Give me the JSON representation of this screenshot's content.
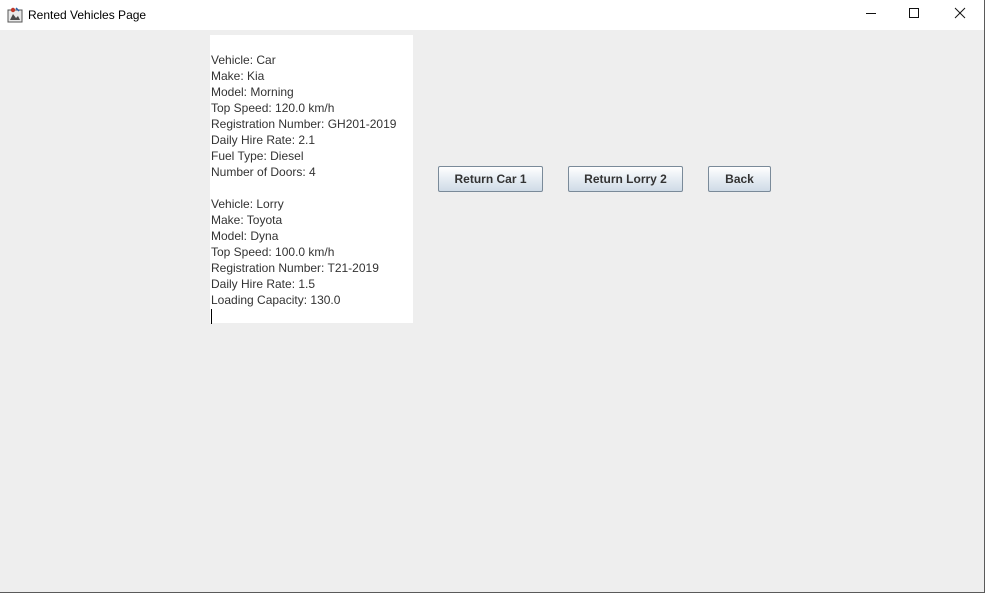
{
  "window": {
    "title": "Rented Vehicles Page",
    "icons": {
      "app": "java-app-icon",
      "minimize": "minimize-icon",
      "maximize": "maximize-icon",
      "close": "close-icon"
    }
  },
  "rented_list": {
    "car": [
      "Vehicle: Car",
      "Make: Kia",
      "Model: Morning",
      "Top Speed: 120.0 km/h",
      "Registration Number:  GH201-2019",
      "Daily Hire Rate: 2.1",
      "Fuel Type: Diesel",
      "Number of Doors: 4"
    ],
    "lorry": [
      "Vehicle: Lorry",
      "Make: Toyota",
      "Model: Dyna",
      "Top Speed: 100.0 km/h",
      "Registration Number: T21-2019",
      "Daily Hire Rate: 1.5",
      "Loading Capacity: 130.0"
    ]
  },
  "actions": {
    "return_car_label": "Return Car 1",
    "return_lorry_label": "Return Lorry 2",
    "back_label": "Back"
  }
}
